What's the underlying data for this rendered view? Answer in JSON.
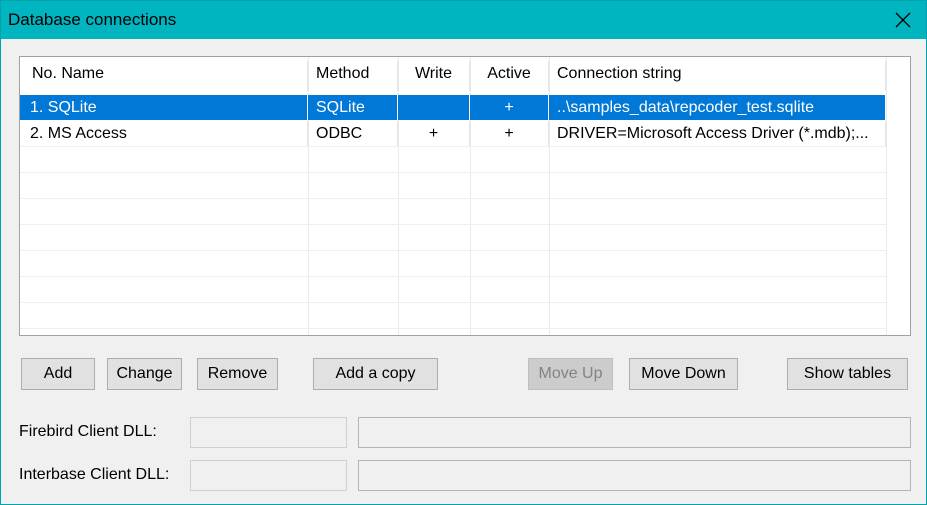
{
  "window": {
    "title": "Database connections"
  },
  "columns": [
    "No. Name",
    "Method",
    "Write",
    "Active",
    "Connection string"
  ],
  "rows": [
    {
      "no_name": "1.  SQLite",
      "method": "SQLite",
      "write": "",
      "active": "+",
      "connection": "..\\samples_data\\repcoder_test.sqlite",
      "selected": true
    },
    {
      "no_name": "2.  MS Access",
      "method": "ODBC",
      "write": "+",
      "active": "+",
      "connection": "DRIVER=Microsoft Access Driver (*.mdb);...",
      "selected": false
    }
  ],
  "buttons": {
    "add": "Add",
    "change": "Change",
    "remove": "Remove",
    "add_copy": "Add a copy",
    "move_up": "Move Up",
    "move_down": "Move Down",
    "show_tables": "Show tables"
  },
  "labels": {
    "firebird": "Firebird Client DLL:",
    "interbase": "Interbase Client DLL:"
  },
  "fields": {
    "firebird_dll": "",
    "firebird_path": "",
    "interbase_dll": "",
    "interbase_path": ""
  },
  "colors": {
    "titlebar": "#00b4c0",
    "selection": "#0078d7"
  }
}
